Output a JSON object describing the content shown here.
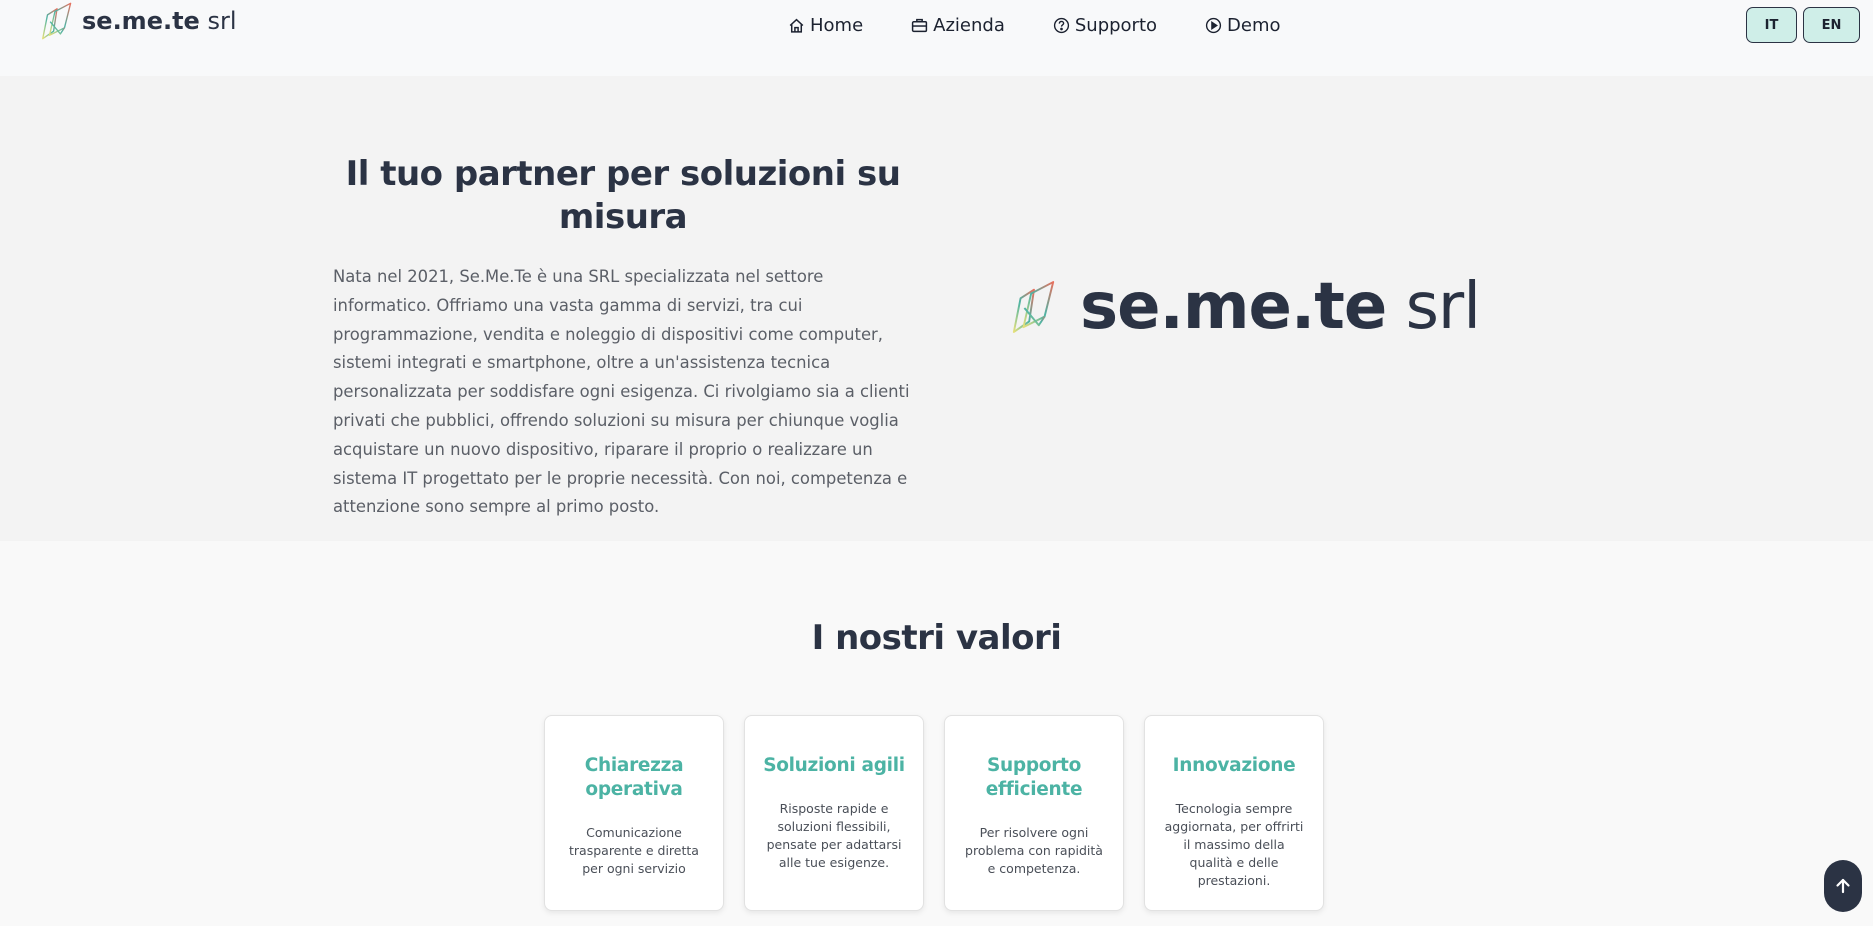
{
  "header": {
    "brand_bold": "se.me.te",
    "brand_light": "srl",
    "nav": [
      {
        "label": "Home",
        "icon": "house-icon"
      },
      {
        "label": "Azienda",
        "icon": "briefcase-icon"
      },
      {
        "label": "Supporto",
        "icon": "question-circle-icon"
      },
      {
        "label": "Demo",
        "icon": "play-circle-icon"
      }
    ],
    "languages": [
      "IT",
      "EN"
    ]
  },
  "hero": {
    "title": "Il tuo partner per soluzioni su misura",
    "text": "Nata nel 2021, Se.Me.Te è una SRL specializzata nel settore informatico. Offriamo una vasta gamma di servizi, tra cui programmazione, vendita e noleggio di dispositivi come computer, sistemi integrati e smartphone, oltre a un'assistenza tecnica personalizzata per soddisfare ogni esigenza. Ci rivolgiamo sia a clienti privati che pubblici, offrendo soluzioni su misura per chiunque voglia acquistare un nuovo dispositivo, riparare il proprio o realizzare un sistema IT progettato per le proprie necessità. Con noi, competenza e attenzione sono sempre al primo posto.",
    "logo_bold": "se.me.te",
    "logo_light": "srl"
  },
  "values": {
    "title": "I nostri valori",
    "cards": [
      {
        "title": "Chiarezza operativa",
        "text": "Comunicazione trasparente e diretta per ogni servizio"
      },
      {
        "title": "Soluzioni agili",
        "text": "Risposte rapide e soluzioni flessibili, pensate per adattarsi alle tue esigenze."
      },
      {
        "title": "Supporto efficiente",
        "text": "Per risolvere ogni problema con rapidità e competenza."
      },
      {
        "title": "Innovazione",
        "text": "Tecnologia sempre aggiornata, per offrirti il massimo della qualità e delle prestazioni."
      }
    ]
  },
  "colors": {
    "accent": "#4cb3a4",
    "dark": "#2b3344",
    "lang_bg": "#cfeee8"
  },
  "scroll_top_icon": "arrow-up-icon"
}
